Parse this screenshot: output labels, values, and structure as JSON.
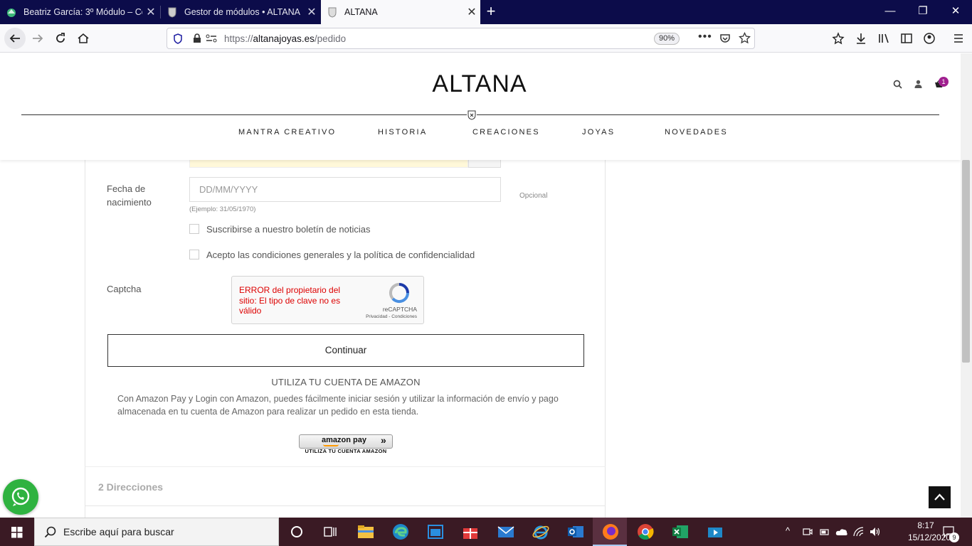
{
  "browser": {
    "tabs": [
      {
        "title": "Beatriz García: 3º Módulo – Cor",
        "active": false
      },
      {
        "title": "Gestor de módulos • ALTANA",
        "active": false
      },
      {
        "title": "ALTANA",
        "active": true
      }
    ],
    "url_prefix": "https://",
    "url_host": "altanajoyas.es",
    "url_path": "/pedido",
    "zoom": "90%"
  },
  "site": {
    "logo": "ALTANA",
    "menu": [
      "MANTRA CREATIVO",
      "HISTORIA",
      "CREACIONES",
      "JOYAS",
      "NOVEDADES"
    ],
    "cart_count": "1"
  },
  "form": {
    "birth_label": "Fecha de nacimiento",
    "birth_placeholder": "DD/MM/YYYY",
    "birth_hint": "(Ejemplo: 31/05/1970)",
    "optional": "Opcional",
    "newsletter": "Suscribirse a nuestro boletín de noticias",
    "terms": "Acepto las condiciones generales y la política de confidencialidad",
    "captcha_label": "Captcha",
    "captcha_error": "ERROR del propietario del sitio: El tipo de clave no es válido",
    "recaptcha": "reCAPTCHA",
    "recaptcha_links": "Privacidad - Condiciones",
    "continue": "Continuar",
    "amazon_title": "UTILIZA TU CUENTA DE AMAZON",
    "amazon_desc": "Con Amazon Pay y Login con Amazon, puedes fácilmente iniciar sesión y utilizar la información de envío y pago almacenada en tu cuenta de Amazon para realizar un pedido en esta tienda.",
    "amazon_btn": "amazon pay",
    "amazon_sub": "UTILIZA TU CUENTA AMAZON",
    "step2": "2 Direcciones"
  },
  "taskbar": {
    "search_placeholder": "Escribe aquí para buscar",
    "time": "8:17",
    "date": "15/12/2020",
    "notifications": "9"
  },
  "colors": {
    "brand_accent": "#a0208f",
    "whatsapp": "#2fb240",
    "captcha_error": "#dd0000"
  }
}
